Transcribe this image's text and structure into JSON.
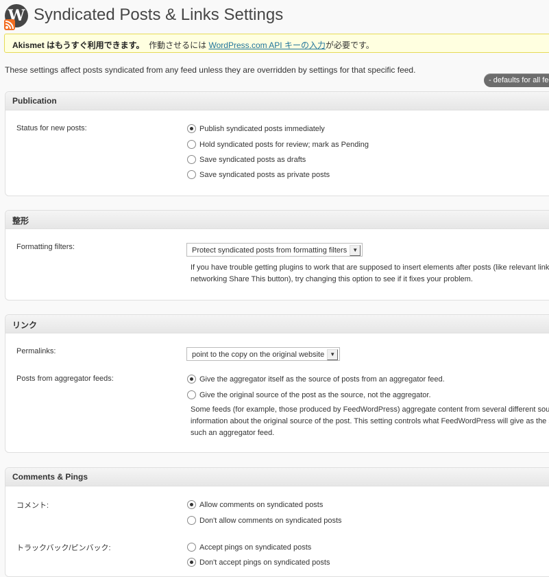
{
  "header": {
    "logo_letter": "W",
    "title": "Syndicated Posts & Links Settings"
  },
  "notice": {
    "bold": "Akismet はもうすぐ利用できます。",
    "text_before": "作動させるには",
    "link": "WordPress.com API キーの入力",
    "text_after": "が必要です。"
  },
  "intro": "These settings affect posts syndicated from any feed unless they are overridden by settings for that specific feed.",
  "defaults_pill": "- defaults for all feeds",
  "publication": {
    "title": "Publication",
    "label": "Status for new posts:",
    "options": [
      "Publish syndicated posts immediately",
      "Hold syndicated posts for review; mark as Pending",
      "Save syndicated posts as drafts",
      "Save syndicated posts as private posts"
    ],
    "selected_index": 0
  },
  "formatting": {
    "title": "整形",
    "label": "Formatting filters:",
    "select_value": "Protect syndicated posts from formatting filters",
    "help": [
      "If you have trouble getting plugins to work that are supposed to insert elements after posts (like relevant links",
      "networking Share This button), try changing this option to see if it fixes your problem."
    ]
  },
  "links": {
    "title": "リンク",
    "permalinks_label": "Permalinks:",
    "permalinks_value": "point to the copy on the original website",
    "aggregator_label": "Posts from aggregator feeds:",
    "aggregator_options": [
      "Give the aggregator itself as the source of posts from an aggregator feed.",
      "Give the original source of the post as the source, not the aggregator."
    ],
    "aggregator_selected": 0,
    "help": [
      "Some feeds (for example, those produced by FeedWordPress) aggregate content from several different sou",
      "information about the original source of the post. This setting controls what FeedWordPress will give as the s",
      "such an aggregator feed."
    ]
  },
  "comments": {
    "title": "Comments & Pings",
    "comment_label": "コメント:",
    "comment_options": [
      "Allow comments on syndicated posts",
      "Don't allow comments on syndicated posts"
    ],
    "comment_selected": 0,
    "ping_label": "トラックバック/ピンバック:",
    "ping_options": [
      "Accept pings on syndicated posts",
      "Don't accept pings on syndicated posts"
    ],
    "ping_selected": 1
  }
}
